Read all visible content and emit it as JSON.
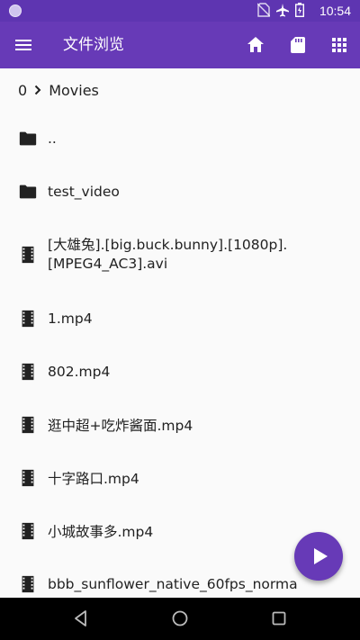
{
  "status_bar": {
    "time": "10:54"
  },
  "toolbar": {
    "title": "文件浏览",
    "accent": "#673ab7",
    "icons": [
      "menu-icon",
      "home-icon",
      "sd-card-icon",
      "grid-view-icon"
    ]
  },
  "path": {
    "root": "0",
    "folder": "Movies"
  },
  "files": [
    {
      "name": "..",
      "type": "folder"
    },
    {
      "name": "test_video",
      "type": "folder"
    },
    {
      "name": "[大雄兔].[big.buck.bunny].[1080p].[MPEG4_AC3].avi",
      "type": "video"
    },
    {
      "name": "1.mp4",
      "type": "video"
    },
    {
      "name": "802.mp4",
      "type": "video"
    },
    {
      "name": "逛中超+吃炸酱面.mp4",
      "type": "video"
    },
    {
      "name": "十字路口.mp4",
      "type": "video"
    },
    {
      "name": "小城故事多.mp4",
      "type": "video"
    },
    {
      "name": "bbb_sunflower_native_60fps_norma",
      "type": "video"
    }
  ]
}
